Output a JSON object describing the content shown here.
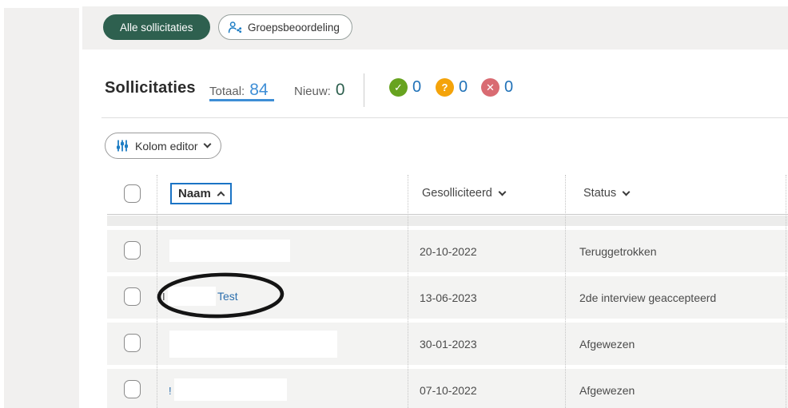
{
  "filter_bar": {
    "all_applications": "Alle sollicitaties",
    "group_review": "Groepsbeoordeling"
  },
  "summary": {
    "title": "Sollicitaties",
    "total_label": "Totaal:",
    "total_value": "84",
    "new_label": "Nieuw:",
    "new_value": "0",
    "badges": [
      {
        "name": "approved",
        "glyph": "✓",
        "count": "0",
        "color": "#67a31f"
      },
      {
        "name": "undecided",
        "glyph": "?",
        "count": "0",
        "color": "#f4a30a"
      },
      {
        "name": "rejected",
        "glyph": "✕",
        "count": "0",
        "color": "#d96b72"
      }
    ]
  },
  "toolbar": {
    "column_editor": "Kolom editor"
  },
  "table": {
    "headers": {
      "name": "Naam",
      "applied": "Gesolliciteerd",
      "status": "Status"
    },
    "rows": [
      {
        "name_prefix": "",
        "name_visible": "",
        "applied": "20-10-2022",
        "status": "Teruggetrokken"
      },
      {
        "name_prefix": "I",
        "name_visible": "Test",
        "applied": "13-06-2023",
        "status": "2de interview geaccepteerd"
      },
      {
        "name_prefix": "",
        "name_visible": "",
        "applied": "30-01-2023",
        "status": "Afgewezen"
      },
      {
        "name_prefix": "!",
        "name_visible": "",
        "applied": "07-10-2022",
        "status": "Afgewezen"
      }
    ]
  },
  "colors": {
    "primary_green": "#2e604f",
    "accent_blue": "#1d7dc4",
    "count_blue": "#2172b8",
    "total_blue": "#3e8ed6",
    "badge_green": "#67a31f",
    "badge_orange": "#f4a30a",
    "badge_red": "#d96b72",
    "row_background": "#f3f3f2"
  }
}
